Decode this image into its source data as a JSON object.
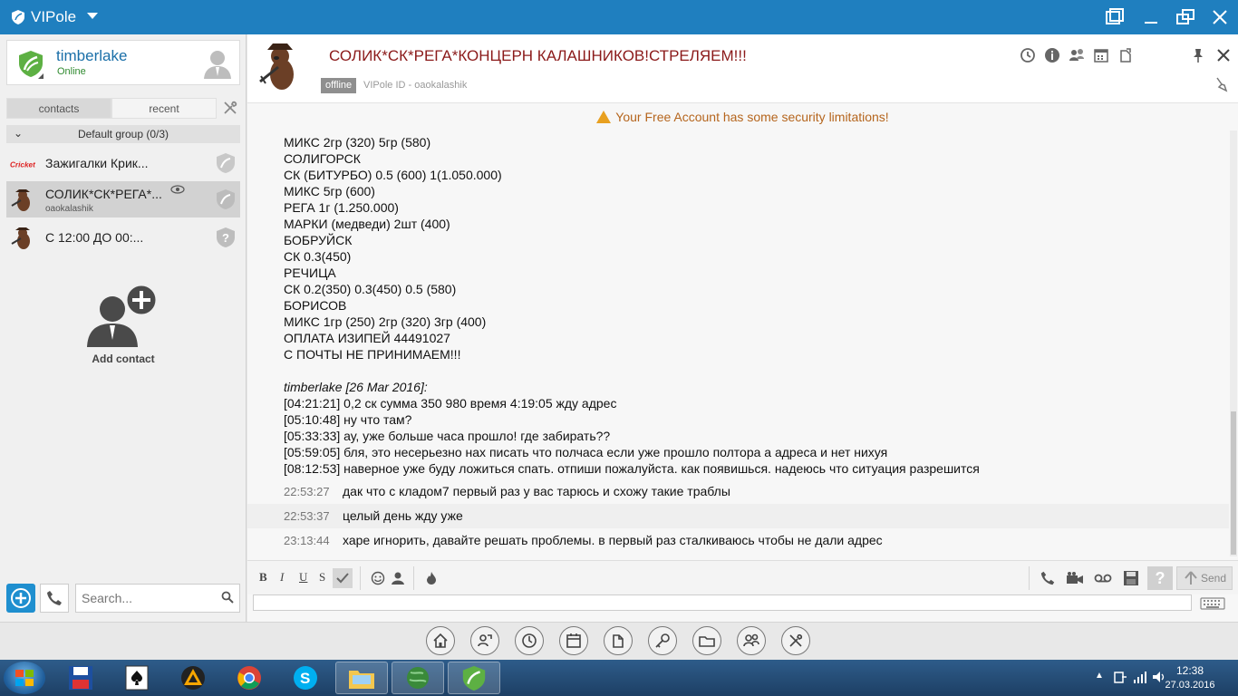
{
  "app": {
    "title": "VIPole"
  },
  "user": {
    "name": "timberlake",
    "status": "Online"
  },
  "tabs": [
    {
      "label": "contacts",
      "active": true
    },
    {
      "label": "recent",
      "active": false
    }
  ],
  "group": {
    "label": "Default group (0/3)"
  },
  "contacts": [
    {
      "name": "Зажигалки Крик...",
      "sub": "",
      "selected": false
    },
    {
      "name": "СОЛИК*СК*РЕГА*...",
      "sub": "oaokalashik",
      "selected": true
    },
    {
      "name": "С 12:00 ДО 00:...",
      "sub": "",
      "selected": false
    }
  ],
  "contact_brand": "Cricket",
  "add_contact_label": "Add contact",
  "search": {
    "placeholder": "Search..."
  },
  "chat": {
    "title": "СОЛИК*СК*РЕГА*КОНЦЕРН КАЛАШНИКОВ!СТРЕЛЯЕМ!!!",
    "status": "offline",
    "vipole_id": "VIPole ID - oaokalashik",
    "warning": "Your Free Account has some security limitations!",
    "body_lines": [
      "МИКС  2гр (320) 5гр (580)",
      "СОЛИГОРСК",
      "СК (БИТУРБО) 0.5 (600) 1(1.050.000)",
      "МИКС   5гр (600)",
      "РЕГА 1г (1.250.000)",
      "МАРКИ (медведи) 2шт (400)",
      "БОБРУЙСК",
      "СК  0.3(450)",
      "РЕЧИЦА",
      "СК 0.2(350) 0.3(450) 0.5 (580)",
      "БОРИСОВ",
      "МИКС 1гр (250) 2гр (320) 3гр (400)",
      "ОПЛАТА ИЗИПЕЙ 44491027",
      "С ПОЧТЫ НЕ ПРИНИМАЕМ!!!"
    ],
    "author_line": "timberlake [26 Mar 2016]:",
    "author_msgs": [
      "[04:21:21] 0,2 ск сумма 350 980 время 4:19:05 жду адрес",
      "[05:10:48] ну что там?",
      "[05:33:33] ау, уже больше часа прошло! где забирать??",
      "[05:59:05] бля, это несерьезно нах писать что полчаса если уже прошло полтора а адреса и нет нихуя",
      "[08:12:53] наверное уже буду ложиться спать. отпиши пожалуйста. как появишься. надеюсь что ситуация разрешится"
    ],
    "timed_msgs": [
      {
        "time": "22:53:27",
        "text": "дак что с кладом7 первый раз у вас тарюсь и схожу такие траблы"
      },
      {
        "time": "22:53:37",
        "text": "целый день жду уже"
      },
      {
        "time": "23:13:44",
        "text": "харе игнорить, давайте решать проблемы. в первый раз сталкиваюсь чтобы не дали адрес"
      }
    ]
  },
  "editor": {
    "bold": "B",
    "italic": "I",
    "underline": "U",
    "strike": "S",
    "help": "?",
    "send": "Send"
  },
  "taskbar": {
    "time": "12:38",
    "date": "27.03.2016"
  },
  "colors": {
    "titlebar": "#1f7fbf",
    "brand_green": "#5db043",
    "chat_title": "#8b1a1a",
    "warning": "#b5651d"
  }
}
